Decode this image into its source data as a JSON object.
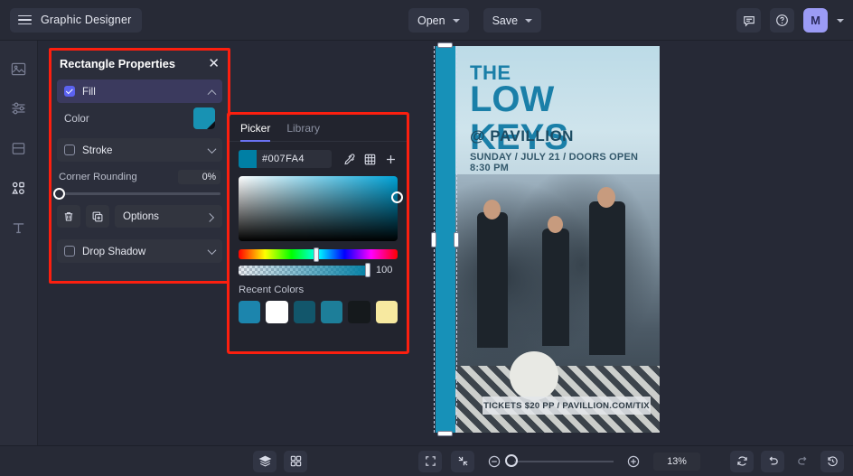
{
  "topbar": {
    "menu_icon": "hamburger-icon",
    "document_title": "Graphic Designer",
    "open_label": "Open",
    "save_label": "Save",
    "comment_icon": "comment-icon",
    "help_icon": "help-circle-icon",
    "avatar_initial": "M"
  },
  "rail": {
    "items": [
      {
        "icon": "image-icon",
        "name": "images"
      },
      {
        "icon": "sliders-icon",
        "name": "adjustments"
      },
      {
        "icon": "pages-icon",
        "name": "pages"
      },
      {
        "icon": "shapes-icon",
        "name": "shapes"
      },
      {
        "icon": "text-icon",
        "name": "text"
      }
    ]
  },
  "properties_panel": {
    "title": "Rectangle Properties",
    "close_icon": "close-icon",
    "fill": {
      "label": "Fill",
      "checked": true,
      "chevron": "chevron-up-icon"
    },
    "color": {
      "label": "Color",
      "swatch_hex": "#007FA4"
    },
    "stroke": {
      "label": "Stroke",
      "checked": false,
      "chevron": "chevron-down-icon"
    },
    "corner_rounding": {
      "label": "Corner Rounding",
      "value": "0%",
      "slider_position": 0
    },
    "actions": {
      "delete_icon": "trash-icon",
      "duplicate_icon": "duplicate-icon",
      "options_label": "Options",
      "options_chevron": "chevron-right-icon"
    },
    "drop_shadow": {
      "label": "Drop Shadow",
      "checked": false,
      "chevron": "chevron-down-icon"
    }
  },
  "color_picker": {
    "tabs": [
      {
        "label": "Picker",
        "active": true
      },
      {
        "label": "Library",
        "active": false
      }
    ],
    "hex_value": "#007FA4",
    "swatch_hex": "#007FA4",
    "eyedropper_icon": "eyedropper-icon",
    "palette_icon": "grid-palette-icon",
    "add_icon": "plus-icon",
    "alpha_value": "100",
    "hue_position_pct": 50,
    "recent_colors_label": "Recent Colors",
    "recent_colors": [
      "#1C85AD",
      "#FFFFFF",
      "#12566B",
      "#1D7E99",
      "#15191C",
      "#F7E9A0"
    ]
  },
  "canvas": {
    "poster": {
      "line_the": "THE",
      "line_title": "LOW KEYS",
      "line_venue": "@ PAVILLION",
      "line_date": "SUNDAY / JULY 21 / DOORS OPEN 8:30 PM",
      "line_tickets": "TICKETS $20 PP  /  PAVILLION.COM/TIX",
      "selected_shape_color": "#1791B8"
    }
  },
  "bottombar": {
    "layers_icon": "layers-icon",
    "grid_icon": "grid-icon",
    "fit_icon": "fit-to-screen-icon",
    "shrink_icon": "shrink-icon",
    "zoom_out_icon": "zoom-out-icon",
    "zoom_in_icon": "zoom-in-icon",
    "zoom_value": "13%",
    "refresh_icon": "refresh-icon",
    "undo_icon": "undo-icon",
    "redo_icon": "redo-icon",
    "history_icon": "history-icon"
  }
}
